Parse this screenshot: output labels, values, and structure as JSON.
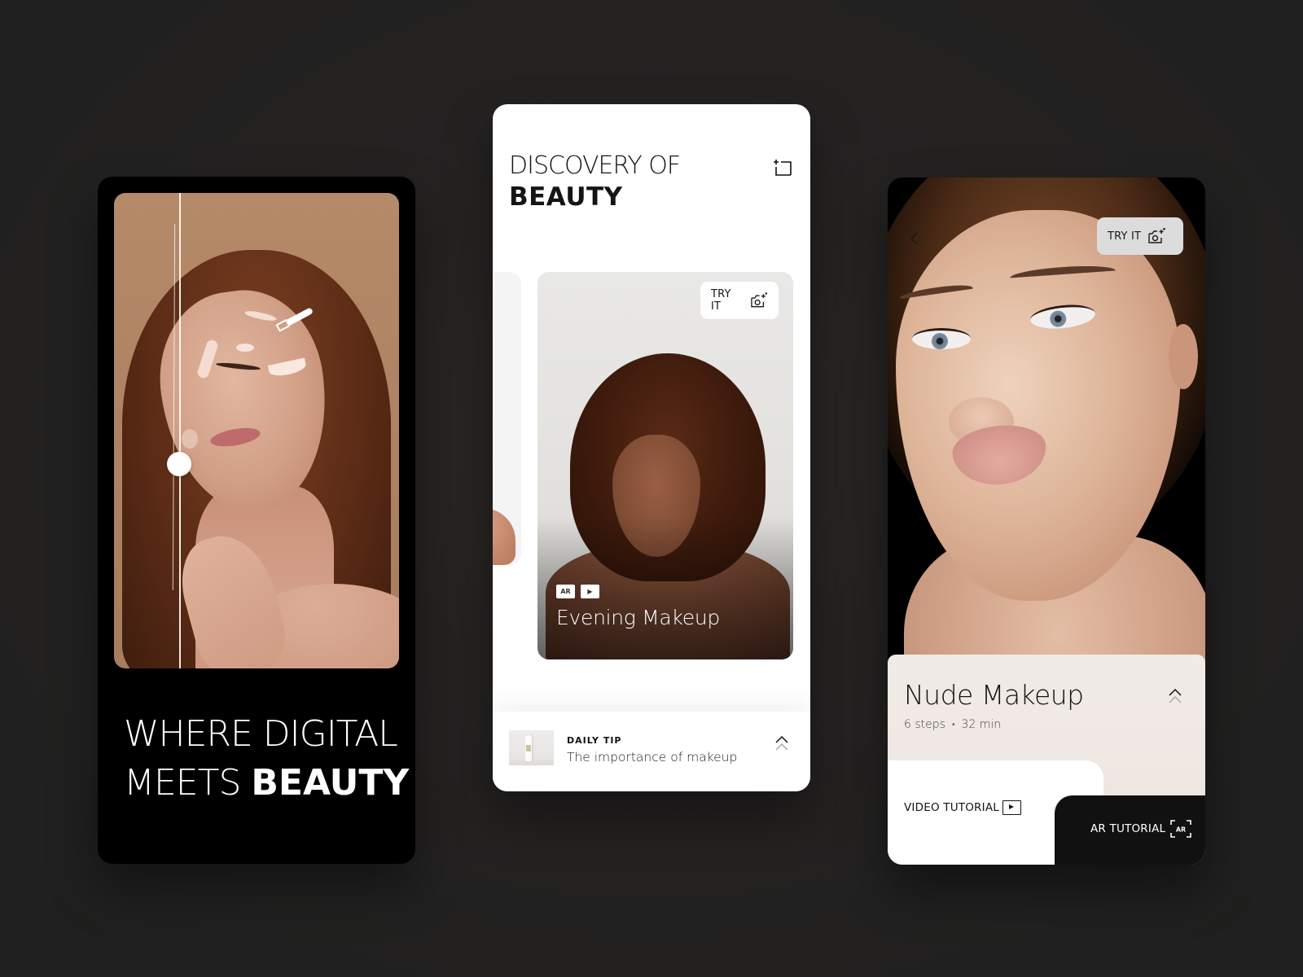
{
  "theme": {
    "background": "#232323",
    "left_screen_bg": "#000000",
    "mid_screen_bg": "#ffffff",
    "right_sheet_bg": "#f0e9e4",
    "ar_button_bg": "#111111"
  },
  "screen_left": {
    "headline_line1": "WHERE DIGITAL",
    "headline_line2_light": "MEETS",
    "headline_line2_bold": "BEAUTY",
    "photo_alt": "Woman with closed eyes and highlighter marks, before/after comparison slider",
    "compare_slider_position": 0.22,
    "icons": [
      "makeup-brush-icon",
      "compare-slider-handle"
    ]
  },
  "screen_mid": {
    "title_light": "DISCOVERY OF",
    "title_bold": "BEAUTY",
    "header_icon": "crop-add-icon",
    "feature_card": {
      "title": "Evening Makeup",
      "try_label": "TRY IT",
      "try_icon": "camera-sparkle-icon",
      "badges": [
        "AR",
        "▶"
      ]
    },
    "daily_tip": {
      "label": "DAILY TIP",
      "text": "The importance of makeup",
      "icon": "chevron-up-double-icon"
    }
  },
  "screen_right": {
    "back_icon": "chevron-left-icon",
    "try_label": "TRY IT",
    "try_icon": "camera-sparkle-icon",
    "detail": {
      "title": "Nude Makeup",
      "steps": "6 steps",
      "separator": "•",
      "duration": "32 min"
    },
    "video_tutorial_label": "VIDEO TUTORIAL",
    "ar_tutorial_label": "AR TUTORIAL",
    "ar_icon_text": "AR"
  }
}
